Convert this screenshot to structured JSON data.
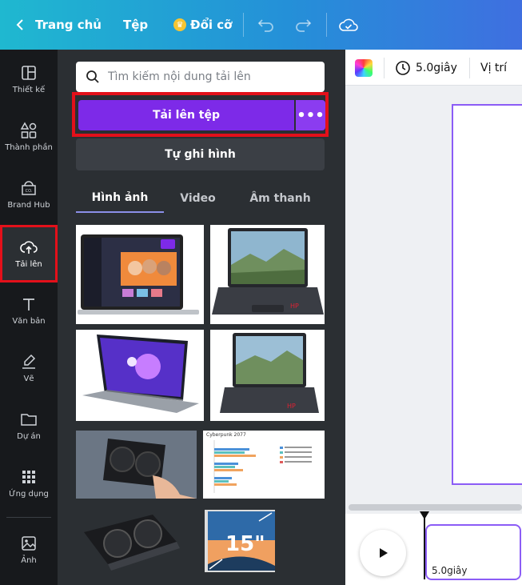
{
  "topbar": {
    "home_label": "Trang chủ",
    "file_label": "Tệp",
    "resize_label": "Đổi cỡ"
  },
  "rail": {
    "items": [
      {
        "label": "Thiết kế",
        "icon": "layout-icon"
      },
      {
        "label": "Thành phần",
        "icon": "shapes-icon"
      },
      {
        "label": "Brand Hub",
        "icon": "brand-hub-icon"
      },
      {
        "label": "Tải lên",
        "icon": "cloud-upload-icon"
      },
      {
        "label": "Văn bản",
        "icon": "text-icon"
      },
      {
        "label": "Vẽ",
        "icon": "draw-icon"
      },
      {
        "label": "Dự án",
        "icon": "folder-icon"
      },
      {
        "label": "Ứng dụng",
        "icon": "apps-grid-icon"
      },
      {
        "label": "Ảnh",
        "icon": "image-icon"
      }
    ],
    "active": "Tải lên"
  },
  "panel": {
    "search_placeholder": "Tìm kiếm nội dung tải lên",
    "upload_button": "Tải lên tệp",
    "more_button": "•••",
    "record_button": "Tự ghi hình",
    "tabs": [
      {
        "label": "Hình ảnh",
        "active": true
      },
      {
        "label": "Video",
        "active": false
      },
      {
        "label": "Âm thanh",
        "active": false
      }
    ],
    "chart_thumb_title": "Cyberpunk 2077",
    "laptop_size_label": "15\""
  },
  "editor": {
    "duration_label": "5.0giây",
    "position_label": "Vị trí",
    "clip_duration": "5.0giây"
  },
  "colors": {
    "accent_purple": "#7d2ae8",
    "highlight_red": "#e3101a",
    "canvas_border": "#8b5cf6"
  }
}
